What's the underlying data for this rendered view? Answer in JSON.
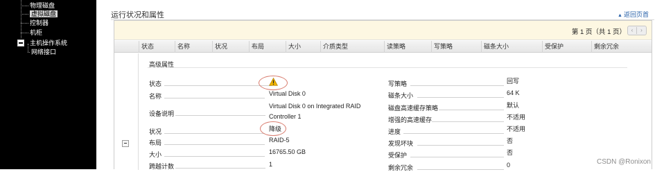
{
  "sidebar": {
    "items": [
      {
        "label": "物理磁盘"
      },
      {
        "label": "虚拟磁盘"
      },
      {
        "label": "控制器"
      },
      {
        "label": "机柜"
      },
      {
        "label": "主机操作系统"
      },
      {
        "label": "网络接口"
      }
    ]
  },
  "header": {
    "title": "运行状况和属性",
    "back_to_top": "返回页首"
  },
  "pager": {
    "text": "第 1 页（共 1 页）",
    "prev": "‹",
    "next": "›"
  },
  "columns": [
    "状态",
    "名称",
    "状况",
    "布局",
    "大小",
    "介质类型",
    "读策略",
    "写策略",
    "磁条大小",
    "受保护",
    "剩余冗余"
  ],
  "section_title": "高级属性",
  "left_props": [
    {
      "label": "状态",
      "value": ""
    },
    {
      "label": "名称",
      "value": "Virtual Disk 0"
    },
    {
      "label": "设备说明",
      "value": "Virtual Disk 0 on Integrated RAID Controller 1"
    },
    {
      "label": "状况",
      "value": "降级"
    },
    {
      "label": "布局",
      "value": "RAID-5"
    },
    {
      "label": "大小",
      "value": "16765.50 GB"
    },
    {
      "label": "跨越计数",
      "value": "1"
    }
  ],
  "left_value_lines": {
    "device_desc_line1": "Virtual Disk 0 on Integrated RAID",
    "device_desc_line2": "Controller 1"
  },
  "right_props": [
    {
      "label": "写策略",
      "value": "回写"
    },
    {
      "label": "磁条大小",
      "value": "64 K"
    },
    {
      "label": "磁盘高速缓存策略",
      "value": "默认"
    },
    {
      "label": "增强的高速缓存",
      "value": "不适用"
    },
    {
      "label": "进度",
      "value": "不适用"
    },
    {
      "label": "发现坏块",
      "value": "否"
    },
    {
      "label": "受保护",
      "value": "否"
    },
    {
      "label": "剩余冗余",
      "value": "0"
    }
  ],
  "icons": {
    "warning": "warning-triangle-icon"
  },
  "colors": {
    "sidebar_bg": "#000000",
    "pager_bg": "#fdf7e2",
    "link": "#2760a8",
    "warning": "#f0b400",
    "highlight_ellipse": "#d87a6c"
  },
  "watermark": "CSDN @Ronixon"
}
